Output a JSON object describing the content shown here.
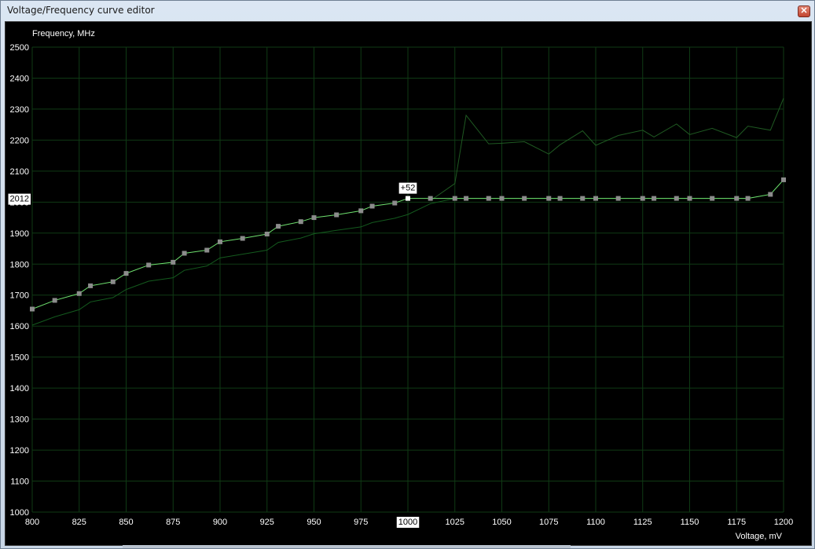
{
  "window": {
    "title": "Voltage/Frequency curve editor",
    "close_glyph": "✕"
  },
  "colors": {
    "background": "#000000",
    "grid": "#0f3a14",
    "curve": "#6ee06e",
    "curve_points": "#8c8c8c",
    "selected_point": "#ffffff",
    "base_curve": "#145a1e",
    "max_curve": "#1f5a22",
    "label_text": "#ffffff"
  },
  "chart_data": {
    "type": "line",
    "xlabel": "Voltage, mV",
    "ylabel": "Frequency, MHz",
    "xlim": [
      800,
      1200
    ],
    "ylim": [
      1000,
      2500
    ],
    "x_ticks": [
      800,
      825,
      850,
      875,
      900,
      925,
      950,
      975,
      1000,
      1025,
      1050,
      1075,
      1100,
      1125,
      1150,
      1175,
      1200
    ],
    "y_ticks": [
      1000,
      1100,
      1200,
      1300,
      1400,
      1500,
      1600,
      1700,
      1800,
      1900,
      2000,
      2100,
      2200,
      2300,
      2400,
      2500
    ],
    "grid": true,
    "selected": {
      "voltage": 1000,
      "voltage_label": "1000",
      "frequency": 2012,
      "frequency_label": "2012",
      "offset_label": "+52"
    },
    "series": [
      {
        "role": "editable curve",
        "x": [
          800,
          812,
          825,
          831,
          843,
          850,
          862,
          875,
          881,
          893,
          900,
          912,
          925,
          931,
          943,
          950,
          962,
          975,
          981,
          993,
          1000,
          1012,
          1025,
          1031,
          1043,
          1050,
          1062,
          1075,
          1081,
          1093,
          1100,
          1112,
          1125,
          1131,
          1143,
          1150,
          1162,
          1175,
          1181,
          1193,
          1200
        ],
        "y": [
          1655,
          1683,
          1705,
          1730,
          1743,
          1770,
          1797,
          1806,
          1835,
          1845,
          1872,
          1883,
          1897,
          1922,
          1937,
          1950,
          1959,
          1972,
          1987,
          1997,
          2012,
          2012,
          2012,
          2012,
          2012,
          2012,
          2012,
          2012,
          2012,
          2012,
          2012,
          2012,
          2012,
          2012,
          2012,
          2012,
          2012,
          2012,
          2012,
          2025,
          2072
        ]
      },
      {
        "role": "base curve",
        "x": [
          800,
          812,
          825,
          831,
          843,
          850,
          862,
          875,
          881,
          893,
          900,
          912,
          925,
          931,
          943,
          950,
          962,
          975,
          981,
          993,
          1000,
          1012,
          1025,
          1031,
          1043,
          1050,
          1062,
          1075,
          1081,
          1093,
          1100,
          1112,
          1125,
          1131,
          1143,
          1150,
          1162,
          1175,
          1181,
          1193,
          1200
        ],
        "y": [
          1603,
          1630,
          1653,
          1678,
          1692,
          1718,
          1745,
          1756,
          1780,
          1794,
          1820,
          1832,
          1845,
          1870,
          1884,
          1898,
          1909,
          1920,
          1934,
          1948,
          1960,
          1995,
          2012,
          2012,
          2012,
          2012,
          2012,
          2012,
          2012,
          2012,
          2012,
          2012,
          2012,
          2012,
          2012,
          2012,
          2012,
          2012,
          2012,
          2025,
          2072
        ]
      },
      {
        "role": "max curve",
        "x": [
          1012,
          1025,
          1031,
          1043,
          1050,
          1062,
          1075,
          1081,
          1093,
          1100,
          1112,
          1125,
          1131,
          1143,
          1150,
          1162,
          1175,
          1181,
          1193,
          1200
        ],
        "y": [
          2005,
          2060,
          2280,
          2188,
          2190,
          2195,
          2155,
          2185,
          2230,
          2183,
          2215,
          2232,
          2210,
          2252,
          2218,
          2238,
          2208,
          2245,
          2232,
          2335
        ]
      }
    ]
  }
}
